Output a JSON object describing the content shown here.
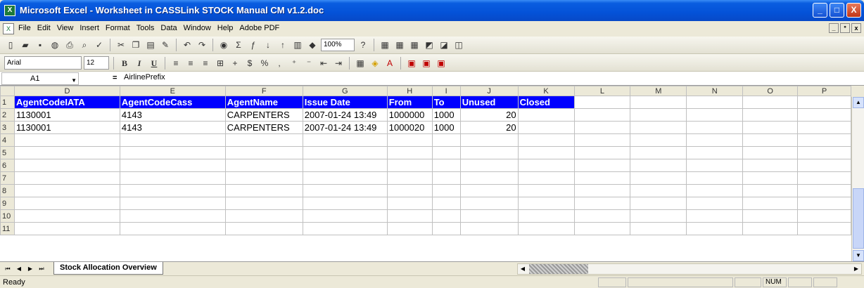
{
  "window": {
    "title": "Microsoft Excel - Worksheet in CASSLink STOCK Manual CM v1.2.doc",
    "app_icon": "X",
    "min": "_",
    "max": "□",
    "close": "X"
  },
  "menu": {
    "items": [
      "File",
      "Edit",
      "View",
      "Insert",
      "Format",
      "Tools",
      "Data",
      "Window",
      "Help",
      "Adobe PDF"
    ],
    "mdi_min": "_",
    "mdi_restore": "ᐤ",
    "mdi_close": "x"
  },
  "toolbar": {
    "zoom": "100%",
    "font": "Arial",
    "size": "12",
    "bold": "B",
    "italic": "I",
    "underline": "U"
  },
  "formula_bar": {
    "cell_ref": "A1",
    "eq": "=",
    "value": "AirlinePrefix"
  },
  "sheet": {
    "columns": [
      "D",
      "E",
      "F",
      "G",
      "H",
      "I",
      "J",
      "K",
      "L",
      "M",
      "N",
      "O",
      "P"
    ],
    "rows": [
      {
        "n": "1",
        "cells": [
          "AgentCodeIATA",
          "AgentCodeCass",
          "AgentName",
          "Issue Date",
          "From",
          "To",
          "Unused",
          "Closed",
          "",
          "",
          "",
          "",
          ""
        ]
      },
      {
        "n": "2",
        "cells": [
          "1130001",
          "4143",
          "CARPENTERS",
          "2007-01-24 13:49",
          "1000000",
          "1000",
          "20",
          "",
          "",
          "",
          "",
          "",
          ""
        ]
      },
      {
        "n": "3",
        "cells": [
          "1130001",
          "4143",
          "CARPENTERS",
          "2007-01-24 13:49",
          "1000020",
          "1000",
          "20",
          "",
          "",
          "",
          "",
          "",
          ""
        ]
      },
      {
        "n": "4",
        "cells": [
          "",
          "",
          "",
          "",
          "",
          "",
          "",
          "",
          "",
          "",
          "",
          "",
          ""
        ]
      },
      {
        "n": "5",
        "cells": [
          "",
          "",
          "",
          "",
          "",
          "",
          "",
          "",
          "",
          "",
          "",
          "",
          ""
        ]
      },
      {
        "n": "6",
        "cells": [
          "",
          "",
          "",
          "",
          "",
          "",
          "",
          "",
          "",
          "",
          "",
          "",
          ""
        ]
      },
      {
        "n": "7",
        "cells": [
          "",
          "",
          "",
          "",
          "",
          "",
          "",
          "",
          "",
          "",
          "",
          "",
          ""
        ]
      },
      {
        "n": "8",
        "cells": [
          "",
          "",
          "",
          "",
          "",
          "",
          "",
          "",
          "",
          "",
          "",
          "",
          ""
        ]
      },
      {
        "n": "9",
        "cells": [
          "",
          "",
          "",
          "",
          "",
          "",
          "",
          "",
          "",
          "",
          "",
          "",
          ""
        ]
      },
      {
        "n": "10",
        "cells": [
          "",
          "",
          "",
          "",
          "",
          "",
          "",
          "",
          "",
          "",
          "",
          "",
          ""
        ]
      },
      {
        "n": "11",
        "cells": [
          "",
          "",
          "",
          "",
          "",
          "",
          "",
          "",
          "",
          "",
          "",
          "",
          ""
        ]
      }
    ]
  },
  "tabs": {
    "active": "Stock Allocation Overview"
  },
  "status": {
    "text": "Ready",
    "num": "NUM"
  }
}
